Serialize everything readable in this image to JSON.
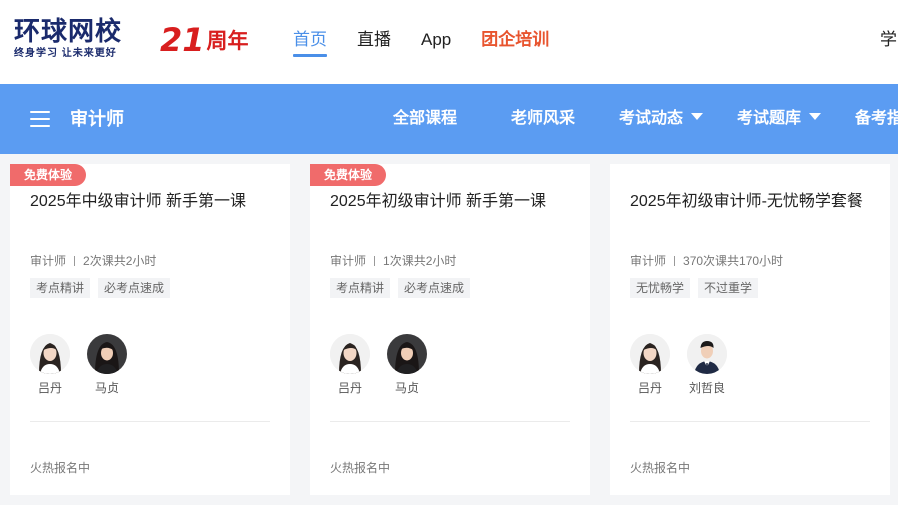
{
  "header": {
    "logo_main": "环球网校",
    "logo_sub": "终身学习 让未来更好",
    "anniversary_num": "21",
    "anniversary_text": "周年",
    "nav": [
      {
        "label": "首页",
        "active": true
      },
      {
        "label": "直播",
        "active": false
      },
      {
        "label": "App",
        "active": false
      },
      {
        "label": "团企培训",
        "active": false
      }
    ],
    "right_label": "学"
  },
  "category_bar": {
    "title": "审计师",
    "items": [
      {
        "label": "全部课程"
      },
      {
        "label": "老师风采"
      },
      {
        "label": "考试动态"
      },
      {
        "label": "考试题库"
      },
      {
        "label": "备考指"
      }
    ]
  },
  "cards": [
    {
      "badge": "免费体验",
      "title": "2025年中级审计师 新手第一课",
      "category": "审计师",
      "lessons": "2次课共2小时",
      "tags": [
        "考点精讲",
        "必考点速成"
      ],
      "teachers": [
        "吕丹",
        "马贞"
      ],
      "status": "火热报名中"
    },
    {
      "badge": "免费体验",
      "title": "2025年初级审计师 新手第一课",
      "category": "审计师",
      "lessons": "1次课共2小时",
      "tags": [
        "考点精讲",
        "必考点速成"
      ],
      "teachers": [
        "吕丹",
        "马贞"
      ],
      "status": "火热报名中"
    },
    {
      "badge": "",
      "title": "2025年初级审计师-无忧畅学套餐",
      "category": "审计师",
      "lessons": "370次课共170小时",
      "tags": [
        "无忧畅学",
        "不过重学"
      ],
      "teachers": [
        "吕丹",
        "刘哲良"
      ],
      "status": "火热报名中"
    }
  ],
  "colors": {
    "accent_blue": "#5b9cf2",
    "nav_active": "#4a8fe8",
    "brand_red": "#d81e1e",
    "corp_orange": "#e8542e",
    "badge_red": "#f06b6b"
  }
}
